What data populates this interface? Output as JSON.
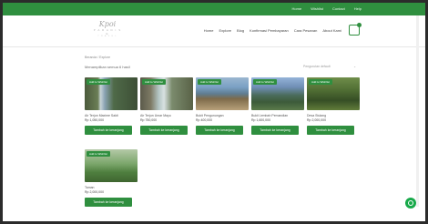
{
  "topbar": {
    "links": [
      "Home",
      "Wishlist",
      "Contact",
      "Help"
    ]
  },
  "header": {
    "logo_text": "Kpoi",
    "logo_sub": "P A R A D I S E",
    "logo_sub2": "T R A V E L",
    "nav": [
      "Home",
      "Explore",
      "Blog",
      "Konfirmasi Pembayaran",
      "Cara Pesanan",
      "About Kami"
    ]
  },
  "main": {
    "breadcrumb": "Beranda / Explore",
    "results_text": "Menampilkan semua 6 hasil",
    "sort_label": "Pengurutan default",
    "products": [
      {
        "name": "Air Terjun Maxime Sakti",
        "price": "Rp 1,050,000",
        "wishlist": "Add to Wishlist",
        "button": "Tambah ke keranjang",
        "img": "waterfall1"
      },
      {
        "name": "Air Terjun Umar Mayo",
        "price": "Rp 750,000",
        "wishlist": "Add to Wishlist",
        "button": "Tambah ke keranjang",
        "img": "waterfall2"
      },
      {
        "name": "Bukit Pengunungan",
        "price": "Rp 400,000",
        "wishlist": "Add to Wishlist",
        "button": "Tambah ke keranjang",
        "img": "mountain"
      },
      {
        "name": "Bukit Lembah Pemandian",
        "price": "Rp 1,600,000",
        "wishlist": "Add to Wishlist",
        "button": "Tambah ke keranjang",
        "img": "valley"
      },
      {
        "name": "Desa Stulang",
        "price": "Rp 2,000,000",
        "wishlist": "Add to Wishlist",
        "button": "Tambah ke keranjang",
        "img": "forest"
      },
      {
        "name": "Taman",
        "price": "Rp 2,000,000",
        "wishlist": "Add to Wishlist",
        "button": "Tambah ke keranjang",
        "img": "flower"
      }
    ]
  },
  "colors": {
    "brand_green": "#2f8f3f",
    "whatsapp": "#18a94a"
  }
}
